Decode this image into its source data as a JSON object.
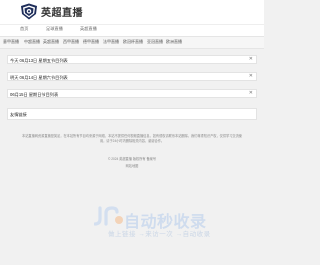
{
  "header": {
    "logo_text": "英超直播"
  },
  "nav_primary": [
    {
      "label": "首页"
    },
    {
      "label": "足球直播"
    },
    {
      "label": "英超直播"
    }
  ],
  "nav_secondary": [
    {
      "label": "意甲直播"
    },
    {
      "label": "中超直播"
    },
    {
      "label": "英超直播"
    },
    {
      "label": "西甲直播"
    },
    {
      "label": "德甲直播"
    },
    {
      "label": "法甲直播"
    },
    {
      "label": "欧冠杯直播"
    },
    {
      "label": "亚冠直播"
    },
    {
      "label": "欧洲直播"
    }
  ],
  "schedule": [
    {
      "title": "今天 06月13日 星期五节目列表",
      "close": "✕"
    },
    {
      "title": "明天 06月14日 星期六节目列表",
      "close": "✕"
    },
    {
      "title": "06月15日 星期日节目列表",
      "close": "✕"
    }
  ],
  "friend_links": {
    "title": "友情链接"
  },
  "footer": {
    "description": "本站直播网资源直播是英足，在本站所有节目均来源于网络，本站不提供任何视频直播信息，如有侵权请联系本站删除。我们尊重知识产权，仅供学习交流使用，请于24小时内删除相关内容，谢谢合作。",
    "copyright": "© 2024 英超直播 版权所有 备案号",
    "sitemap": "网站地图"
  },
  "watermark": {
    "title": "自动秒收录",
    "subtitle": "做上链接 →来访一次 →自动收录"
  }
}
